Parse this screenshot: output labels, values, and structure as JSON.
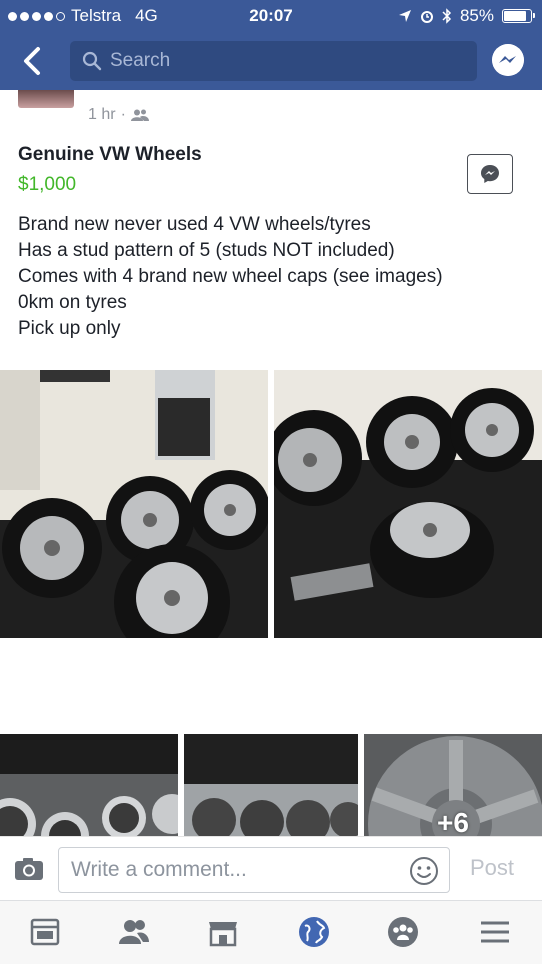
{
  "status": {
    "carrier": "Telstra",
    "network": "4G",
    "time": "20:07",
    "battery": "85%"
  },
  "nav": {
    "search_placeholder": "Search"
  },
  "post": {
    "meta_time": "1 hr",
    "title": "Genuine VW Wheels",
    "price": "$1,000",
    "description": [
      "Brand new never used 4 VW wheels/tyres",
      "Has a stud pattern of 5 (studs NOT included)",
      "Comes with 4 brand new wheel caps (see images)",
      "0km on tyres",
      "Pick up only"
    ],
    "more_photos": "+6"
  },
  "comment": {
    "placeholder": "Write a comment...",
    "post_label": "Post"
  },
  "tabs": [
    "feed-icon",
    "friends-icon",
    "marketplace-icon",
    "notifications-globe-icon",
    "groups-icon",
    "menu-icon"
  ],
  "colors": {
    "brand": "#3b5998",
    "price": "#42b72a",
    "active_tab": "#4267b2"
  }
}
